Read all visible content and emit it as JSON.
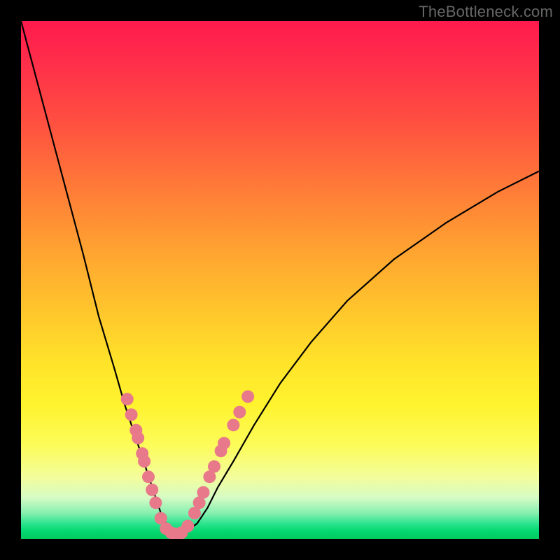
{
  "watermark": "TheBottleneck.com",
  "colors": {
    "frame": "#000000",
    "curve": "#000000",
    "dot": "#e8798a"
  },
  "chart_data": {
    "type": "line",
    "title": "",
    "xlabel": "",
    "ylabel": "",
    "xlim": [
      0,
      100
    ],
    "ylim": [
      0,
      100
    ],
    "series": [
      {
        "name": "bottleneck-curve",
        "x": [
          0,
          4,
          8,
          12,
          15,
          18,
          20,
          22,
          24,
          25,
          26,
          27,
          28,
          29,
          30,
          31,
          32,
          34,
          36,
          38,
          41,
          45,
          50,
          56,
          63,
          72,
          82,
          92,
          100
        ],
        "y": [
          100,
          85,
          70,
          55,
          43,
          33,
          26,
          20,
          14,
          11,
          8,
          5,
          3,
          1.5,
          1,
          1,
          1.5,
          3,
          6,
          10,
          15,
          22,
          30,
          38,
          46,
          54,
          61,
          67,
          71
        ]
      }
    ],
    "markers": {
      "name": "highlight-dots",
      "points": [
        {
          "x": 20.5,
          "y": 27
        },
        {
          "x": 21.3,
          "y": 24
        },
        {
          "x": 22.2,
          "y": 21
        },
        {
          "x": 22.6,
          "y": 19.5
        },
        {
          "x": 23.4,
          "y": 16.5
        },
        {
          "x": 23.8,
          "y": 15
        },
        {
          "x": 24.6,
          "y": 12
        },
        {
          "x": 25.3,
          "y": 9.5
        },
        {
          "x": 26.0,
          "y": 7
        },
        {
          "x": 27.0,
          "y": 4
        },
        {
          "x": 28.0,
          "y": 2
        },
        {
          "x": 29.0,
          "y": 1.2
        },
        {
          "x": 30.0,
          "y": 1
        },
        {
          "x": 31.0,
          "y": 1.2
        },
        {
          "x": 32.2,
          "y": 2.5
        },
        {
          "x": 33.5,
          "y": 5
        },
        {
          "x": 34.4,
          "y": 7
        },
        {
          "x": 35.2,
          "y": 9
        },
        {
          "x": 36.4,
          "y": 12
        },
        {
          "x": 37.3,
          "y": 14
        },
        {
          "x": 38.6,
          "y": 17
        },
        {
          "x": 39.2,
          "y": 18.5
        },
        {
          "x": 41.0,
          "y": 22
        },
        {
          "x": 42.2,
          "y": 24.5
        },
        {
          "x": 43.8,
          "y": 27.5
        }
      ]
    }
  }
}
